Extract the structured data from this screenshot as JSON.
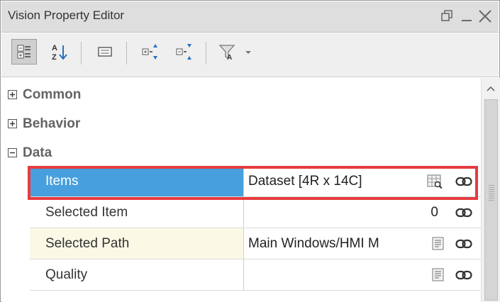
{
  "window": {
    "title": "Vision Property Editor",
    "buttons": [
      "restore-icon",
      "minimize-icon",
      "close-icon"
    ]
  },
  "toolbar": {
    "buttons": [
      {
        "name": "categorized-view-button",
        "icon": "categorized-icon",
        "pressed": true
      },
      {
        "name": "sort-alphabetical-button",
        "icon": "sort-az-icon",
        "pressed": false
      },
      {
        "name": "property-description-button",
        "icon": "description-icon",
        "pressed": false
      },
      {
        "name": "expand-all-button",
        "icon": "expand-all-icon",
        "pressed": false
      },
      {
        "name": "collapse-all-button",
        "icon": "collapse-all-icon",
        "pressed": false
      },
      {
        "name": "filter-button",
        "icon": "filter-icon",
        "pressed": false
      }
    ]
  },
  "categories": [
    {
      "label": "Common",
      "expanded": false
    },
    {
      "label": "Behavior",
      "expanded": false
    },
    {
      "label": "Data",
      "expanded": true
    }
  ],
  "properties": [
    {
      "name": "Items",
      "value": "Dataset [4R x 14C]",
      "icon": "dataset-viewer-icon",
      "selected": true
    },
    {
      "name": "Selected Item",
      "value": "0",
      "icon": null,
      "selected": false
    },
    {
      "name": "Selected Path",
      "value": "Main Windows/HMI M",
      "icon": "text-editor-icon",
      "selected": false
    },
    {
      "name": "Quality",
      "value": "",
      "icon": "text-editor-icon",
      "selected": false
    }
  ],
  "colors": {
    "selection": "#47a0dd",
    "highlight_border": "#e63b3f",
    "alt_row": "#fbf8e6"
  }
}
